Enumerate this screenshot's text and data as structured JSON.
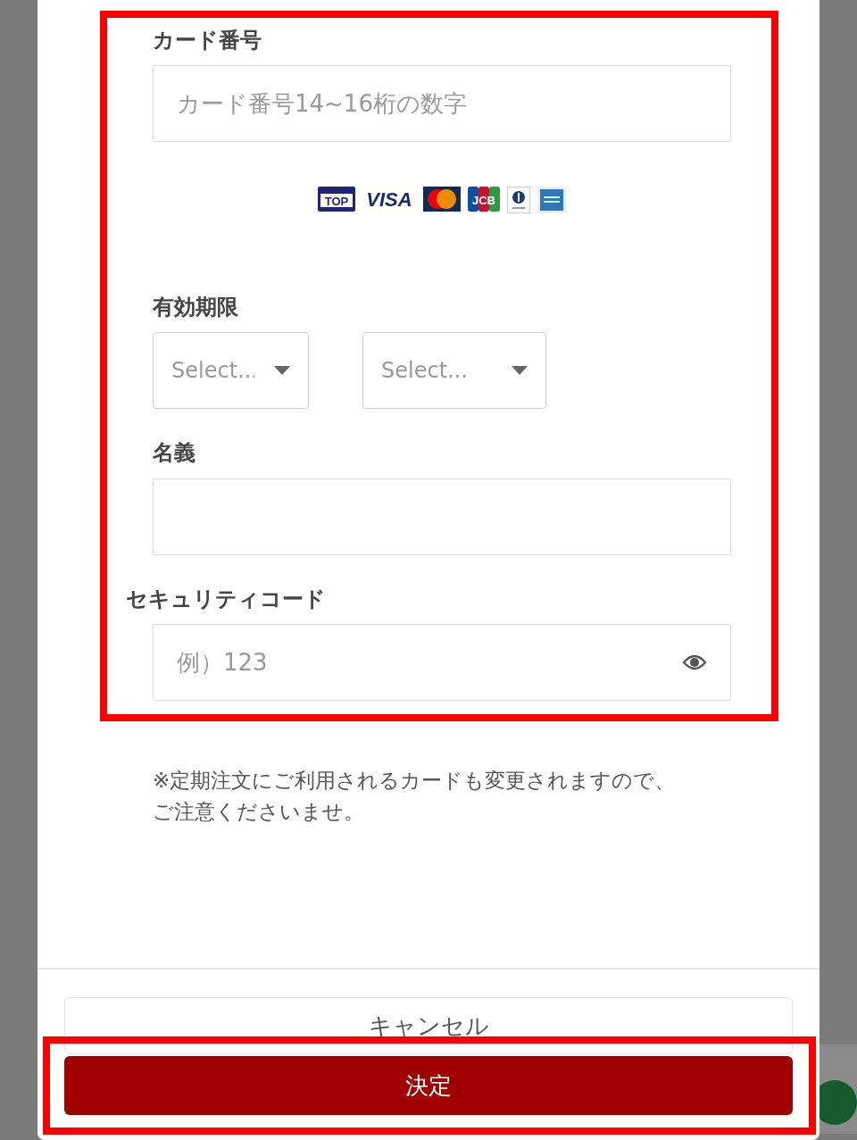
{
  "form": {
    "card_number": {
      "label": "カード番号",
      "placeholder": "カード番号14~16桁の数字"
    },
    "card_brands": [
      {
        "kind": "top",
        "label": "TOP"
      },
      {
        "kind": "visa",
        "label": "VISA"
      },
      {
        "kind": "mastercard"
      },
      {
        "kind": "jcb",
        "label": "JCB"
      },
      {
        "kind": "diners"
      },
      {
        "kind": "amex"
      }
    ],
    "expiry": {
      "label": "有効期限",
      "selects": [
        {
          "placeholder": "Select..."
        },
        {
          "placeholder": "Select..."
        }
      ]
    },
    "holder_name": {
      "label": "名義"
    },
    "security_code": {
      "label": "セキュリティコード",
      "placeholder": "例）123"
    }
  },
  "note": "※定期注文にご利用されるカードも変更されますので、ご注意くださいませ。",
  "buttons": [
    {
      "kind": "secondary",
      "label": "キャンセル"
    },
    {
      "kind": "primary",
      "label": "決定"
    }
  ]
}
